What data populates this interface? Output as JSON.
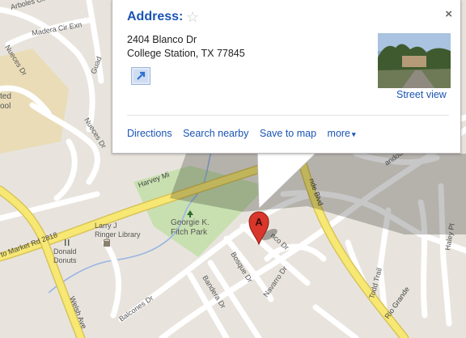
{
  "infowindow": {
    "title": "Address:",
    "close_glyph": "×",
    "star_glyph": "☆",
    "address_line1": "2404 Blanco Dr",
    "address_line2": "College Station, TX 77845",
    "street_view_label": "Street view",
    "actions": {
      "directions": "Directions",
      "search_nearby": "Search nearby",
      "save_to_map": "Save to map",
      "more": "more",
      "more_caret": "▾"
    }
  },
  "marker": {
    "letter": "A",
    "color": "#d9372b"
  },
  "map": {
    "streets": {
      "arboles": "Arboles Cir",
      "madera": "Madera Cir Exn",
      "nueces_dr_upper": "Nueces Dr",
      "nueces_dr": "Nueces Dr",
      "guad": "Guad",
      "harvey": "Harvey Mi",
      "market_rd": "to Market Rd 2818",
      "balcones": "Balcones Dr",
      "bandera": "Bandera Dr",
      "bosque": "Bosque Dr",
      "navarro": "Navarro Dr",
      "blanco": "nco Dr",
      "rio_grande": "Rio Grande",
      "rio_grande_blvd": "nde Blvd",
      "todd": "Todd Trail",
      "haley": "Haley Pl",
      "shenandoah": "andoah Dr",
      "welsh": "Welsh Ave"
    },
    "places": {
      "park_line1": "Georgie K.",
      "park_line2": "Fitch Park",
      "library_line1": "Larry J",
      "library_line2": "Ringer Library",
      "donald_line1": "Donald",
      "donald_line2": "Donuts",
      "school_line1": "ted",
      "school_line2": "ool"
    },
    "colors": {
      "land": "#e8e4dd",
      "road": "#ffffff",
      "highway": "#f7e874",
      "park": "#c8e0b0",
      "campus": "#e9dcb7",
      "water": "#9bb5e3"
    }
  }
}
